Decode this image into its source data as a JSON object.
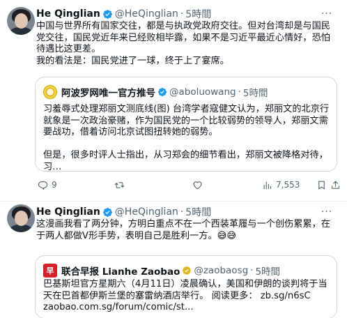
{
  "colors": {
    "accent": "#1d9bf0",
    "verified": "#1d9bf0",
    "muted": "#536471",
    "border": "#cfd9de",
    "zaobao_red": "#d6202a"
  },
  "tweets": [
    {
      "author_name": "He Qinglian",
      "handle": "@HeQinglian",
      "separator": "·",
      "time": "5時間",
      "more": "···",
      "text": "中国与世界所有国家交往，都是与执政党政府交往。但对台湾却是与国民党交往，国民党近年来已经败相毕露，如果不是习近平最近心情好，恐怕待遇比这更差。\n我的看法是：国民党进了一球，终于上了宴席。",
      "quote": {
        "avatar_icon": "sunflower-logo-icon",
        "author_name": "阿波罗网唯一官方推号",
        "handle": "@aboluowang",
        "separator": "·",
        "time": "5時間",
        "text": "习羞辱式处理郑丽文测底线(图) 台湾学者寇健文认为，郑丽文的北京行就象是一次政治豪赌，作为国民党的一个比较弱势的领导人，郑丽文需要战功，借着访问北京试图扭转她的弱势。\n\n但是，很多时评人士指出，从习郑会的细节看出，郑丽文被降格对待，习…"
      },
      "actions": {
        "replies": "9",
        "retweets": "",
        "likes": "",
        "views": "7,553"
      }
    },
    {
      "author_name": "He Qinglian",
      "handle": "@HeQinglian",
      "separator": "·",
      "time": "5時間",
      "more": "···",
      "text": "这漫画我看了两分钟，方明白重点不在一个西装革履与一个创伤累累，在于两人都做V形手势，表明自己是胜利一方。😅😅",
      "quote": {
        "avatar_icon": "zaobao-logo-icon",
        "avatar_glyph": "早",
        "author_name": "联合早报 Lianhe Zaobao",
        "handle": "@zaobaosg",
        "separator": "·",
        "time": "5時間",
        "text": "巴基斯坦官方星期六（4月11日）凌晨确认，美国和伊朗的谈判将于当天在巴首都伊斯兰堡的塞雷纳酒店举行。 阅读更多： zb.sg/n6sC\nzaobao.com.sg/forum/comic/st..."
      }
    }
  ]
}
